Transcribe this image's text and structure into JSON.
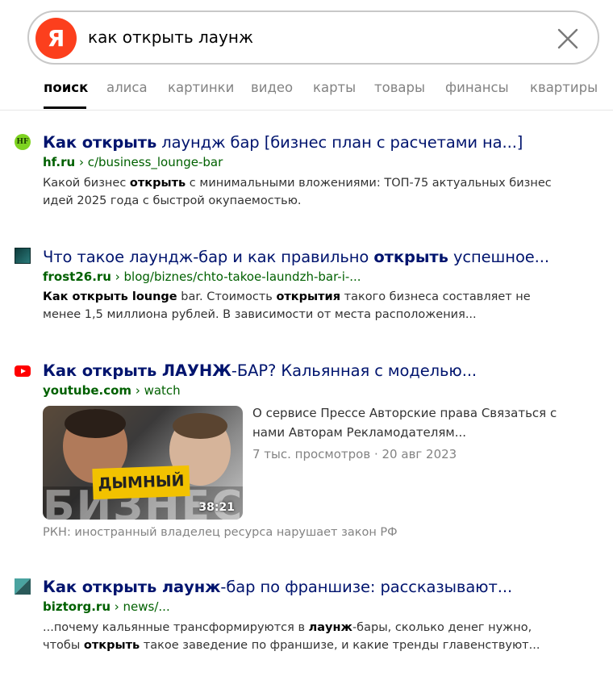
{
  "search": {
    "logo_letter": "Я",
    "query": "как открыть лаунж"
  },
  "tabs": [
    {
      "label": "поиск",
      "active": true
    },
    {
      "label": "алиса"
    },
    {
      "label": "картинки"
    },
    {
      "label": "видео"
    },
    {
      "label": "карты"
    },
    {
      "label": "товары"
    },
    {
      "label": "финансы"
    },
    {
      "label": "квартиры"
    }
  ],
  "results": [
    {
      "favicon": "hf-favicon-icon",
      "favicon_text": "HF",
      "title_bold": "Как открыть",
      "title_rest": " лаундж бар [бизнес план с расчетами на...]",
      "domain": "hf.ru",
      "path": " › c/business_lounge-bar",
      "snippet_1a": "Какой бизнес ",
      "snippet_1b": "открыть",
      "snippet_1c": " с минимальными вложениями: ТОП-75 актуальных бизнес",
      "snippet_2": "идей 2025 года с быстрой окупаемостью."
    },
    {
      "favicon": "frost26-favicon-icon",
      "title_1": "Что такое лаундж-бар и как правильно ",
      "title_bold": "открыть",
      "title_2": " успешное...",
      "domain": "frost26.ru",
      "path": " › blog/biznes/chto-takoe-laundzh-bar-i-...",
      "snippet_1a": "Как открыть lounge",
      "snippet_1b": " bar. Стоимость ",
      "snippet_1c": "открытия",
      "snippet_1d": " такого бизнеса составляет не",
      "snippet_2": "менее 1,5 миллиона рублей. В зависимости от места расположения..."
    },
    {
      "favicon": "youtube-favicon-icon",
      "title_bold": "Как открыть ЛАУНЖ",
      "title_rest": "-БАР? Кальянная с моделью...",
      "domain": "youtube.com",
      "path": " › watch",
      "thumb_banner": "ДЫМНЫЙ",
      "thumb_big": "БИЗНЕС",
      "duration": "38:21",
      "desc_1": "О сервисе Прессе Авторские права Связаться с",
      "desc_2": "нами Авторам Рекламодателям...",
      "views": "7 тыс. просмотров",
      "date": "20 авг 2023",
      "rkn": "РКН: иностранный владелец ресурса нарушает закон РФ"
    },
    {
      "favicon": "biztorg-favicon-icon",
      "title_bold": "Как открыть лаунж",
      "title_rest": "-бар по франшизе: рассказывают...",
      "domain": "biztorg.ru",
      "path": " › news/...",
      "snippet_1a": "...почему кальянные трансформируются в ",
      "snippet_1b": "лаунж",
      "snippet_1c": "-бары, сколько денег нужно,",
      "snippet_2a": "чтобы ",
      "snippet_2b": "открыть",
      "snippet_2c": " такое заведение по франшизе, и какие тренды главенствуют..."
    }
  ],
  "colors": {
    "logo": "#fc3f1d",
    "title": "#00146e",
    "url": "#006000",
    "muted": "#838383"
  }
}
